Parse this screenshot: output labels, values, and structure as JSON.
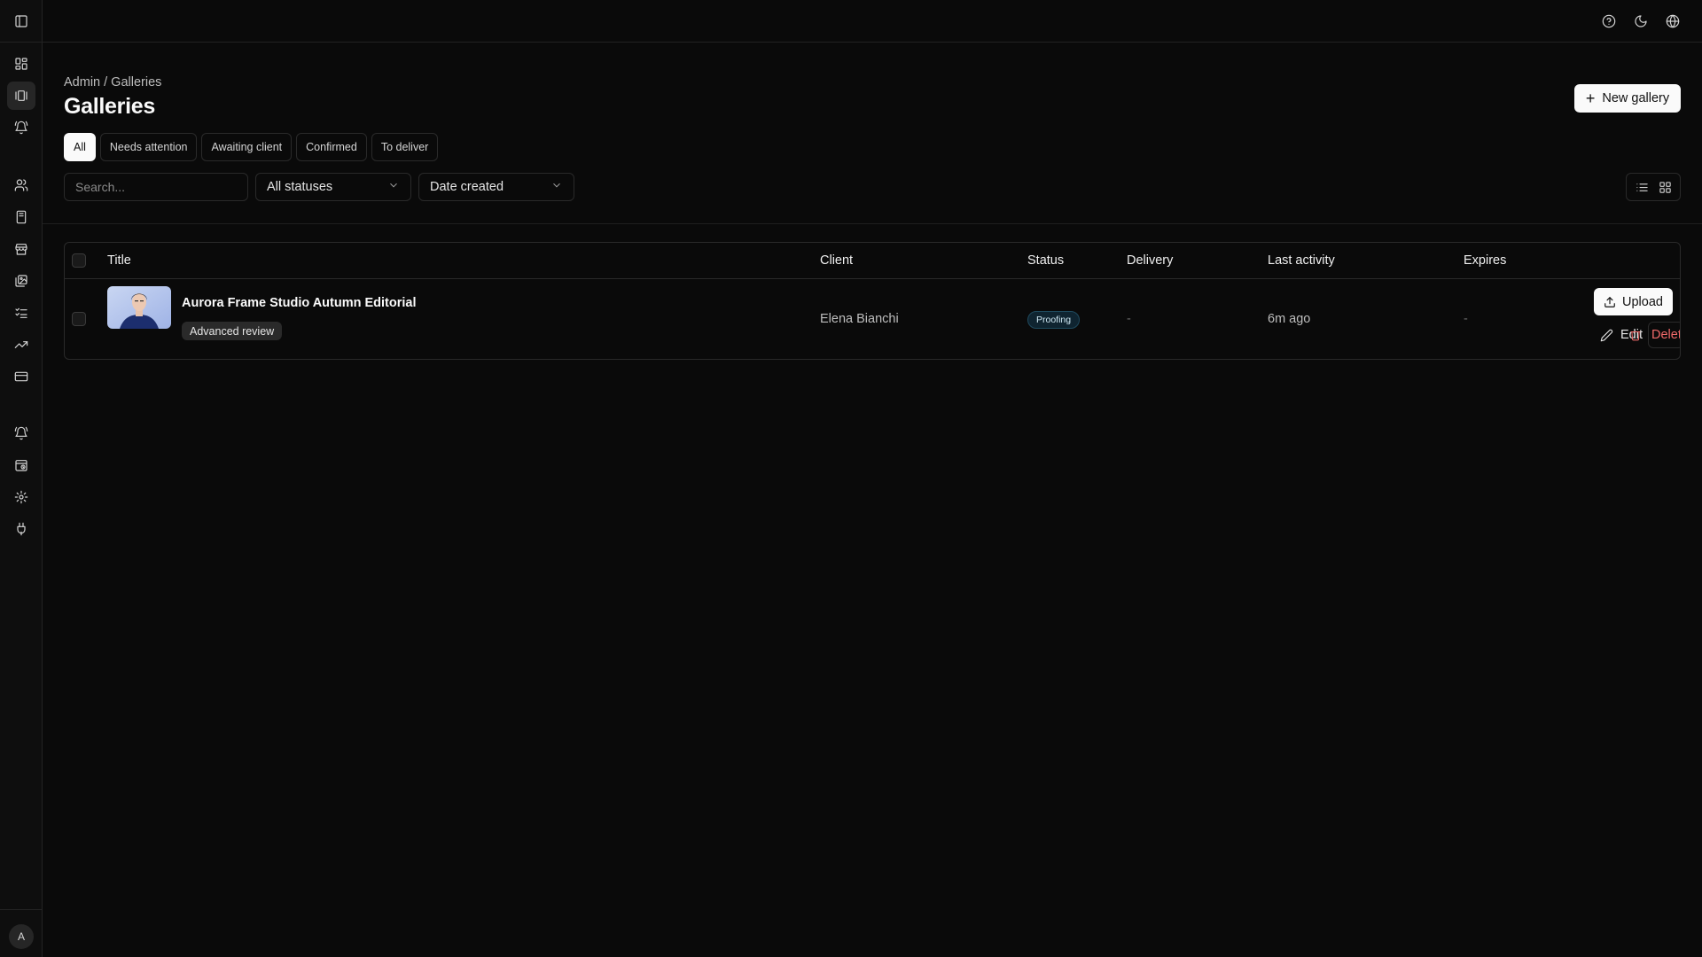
{
  "user": {
    "avatar_initial": "A"
  },
  "header": {
    "icons": [
      "help-icon",
      "moon-icon",
      "globe-icon"
    ]
  },
  "breadcrumb": "Admin / Galleries",
  "page": {
    "title": "Galleries",
    "new_gallery_label": "New gallery"
  },
  "tabs": [
    {
      "label": "All",
      "active": true
    },
    {
      "label": "Needs attention",
      "active": false
    },
    {
      "label": "Awaiting client",
      "active": false
    },
    {
      "label": "Confirmed",
      "active": false
    },
    {
      "label": "To deliver",
      "active": false
    }
  ],
  "filters": {
    "search_placeholder": "Search...",
    "status_select": "All statuses",
    "sort_select": "Date created"
  },
  "table": {
    "columns": [
      "Title",
      "Client",
      "Status",
      "Delivery",
      "Last activity",
      "Expires"
    ],
    "rows": [
      {
        "title": "Aurora Frame Studio Autumn Editorial",
        "tag": "Advanced review",
        "client": "Elena Bianchi",
        "status": "Proofing",
        "delivery": "-",
        "last_activity": "6m ago",
        "expires": "-",
        "actions": {
          "upload": "Upload",
          "edit": "Edit",
          "delete": "Delete"
        }
      }
    ]
  },
  "colors": {
    "accent": "#fafafa",
    "background": "#0a0a0a",
    "danger": "#f06a6a",
    "status_proofing": "#1f4a5e"
  }
}
